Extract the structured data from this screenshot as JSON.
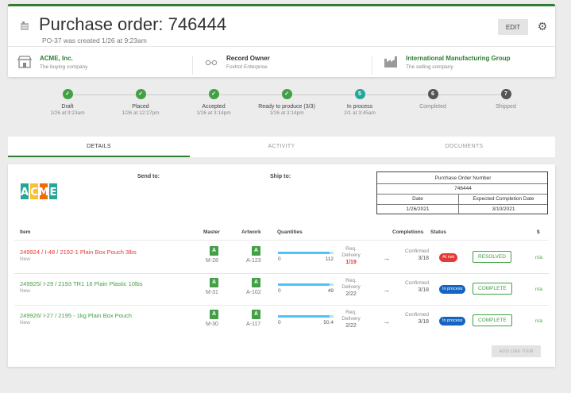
{
  "header": {
    "title": "Purchase order: 746444",
    "subtitle": "PO-37 was created 1/26 at 9:23am",
    "edit_label": "EDIT",
    "parties": [
      {
        "name": "ACME, Inc.",
        "desc": "The buying company",
        "icon": "store-icon"
      },
      {
        "name": "Record Owner",
        "desc": "Foxtrot Enterprise",
        "icon": "glasses-icon"
      },
      {
        "name": "International Manufacturing Group",
        "desc": "The selling company",
        "icon": "factory-icon"
      }
    ]
  },
  "steps": [
    {
      "label": "Draft",
      "date": "1/26 at 9:23am",
      "state": "done",
      "mark": "✓"
    },
    {
      "label": "Placed",
      "date": "1/26 at 12:27pm",
      "state": "done",
      "mark": "✓"
    },
    {
      "label": "Accepted",
      "date": "1/26 at 3:14pm",
      "state": "done",
      "mark": "✓"
    },
    {
      "label": "Ready to produce (3/3)",
      "date": "1/26 at 3:14pm",
      "state": "done",
      "mark": "✓"
    },
    {
      "label": "In process",
      "date": "2/1 at 3:45am",
      "state": "current",
      "mark": "5"
    },
    {
      "label": "Completed",
      "date": "",
      "state": "todo",
      "mark": "6"
    },
    {
      "label": "Shipped",
      "date": "",
      "state": "todo",
      "mark": "7"
    }
  ],
  "tabs": [
    "DETAILS",
    "ACTIVITY",
    "DOCUMENTS"
  ],
  "details": {
    "send_to": "Send to:",
    "ship_to": "Ship to:",
    "logo_text": "ACME",
    "po_box": {
      "header": "Purchase Order Number",
      "number": "746444",
      "date_label": "Date",
      "ecd_label": "Expected Completion Date",
      "date": "1/26/2021",
      "ecd": "3/10/2021"
    },
    "columns": {
      "item": "Item",
      "master": "Master",
      "artwork": "Artwork",
      "quantities": "Quantities",
      "completions": "Completions",
      "status": "Status",
      "cost": "$"
    },
    "req_label": "Req.",
    "delivery_label": "Delivery",
    "confirmed_label": "Confirmed",
    "rows": [
      {
        "name": "249924 / I-48 / 2192-1 Plain Box Pouch 3lbs",
        "status": "New",
        "master_badge": "A",
        "master": "M-28",
        "artwork_badge": "A",
        "artwork": "A-123",
        "qty_min": "0",
        "qty_max": "112",
        "qty_fill": 0.93,
        "req_date": "1/19",
        "req_late": true,
        "confirmed": "3/18",
        "pill": "At risk",
        "pill_color": "#e53935",
        "action": "RESOLVED",
        "cost": "n/a",
        "name_color": "#e53935"
      },
      {
        "name": "249925/ I-29 / 2193 TR1 16 Plain Plastic 10lbs",
        "status": "New",
        "master_badge": "A",
        "master": "M-31",
        "artwork_badge": "A",
        "artwork": "A-102",
        "qty_min": "0",
        "qty_max": "49",
        "qty_fill": 0.93,
        "req_date": "2/22",
        "req_late": false,
        "confirmed": "3/18",
        "pill": "In process",
        "pill_color": "#1565c0",
        "action": "COMPLETE",
        "cost": "n/a",
        "name_color": "#43a047"
      },
      {
        "name": "249926/ I-27 / 2195 - 1kg Plain Box Pouch",
        "status": "New",
        "master_badge": "A",
        "master": "M-30",
        "artwork_badge": "A",
        "artwork": "A-117",
        "qty_min": "0",
        "qty_max": "50.4",
        "qty_fill": 0.93,
        "req_date": "2/22",
        "req_late": false,
        "confirmed": "3/18",
        "pill": "In process",
        "pill_color": "#1565c0",
        "action": "COMPLETE",
        "cost": "n/a",
        "name_color": "#43a047"
      }
    ],
    "add_line_label": "ADD LINE ITEM"
  },
  "colors": {
    "accent": "#2e7d32",
    "step_done": "#43a047",
    "step_current": "#26a69a",
    "step_todo": "#555555"
  }
}
